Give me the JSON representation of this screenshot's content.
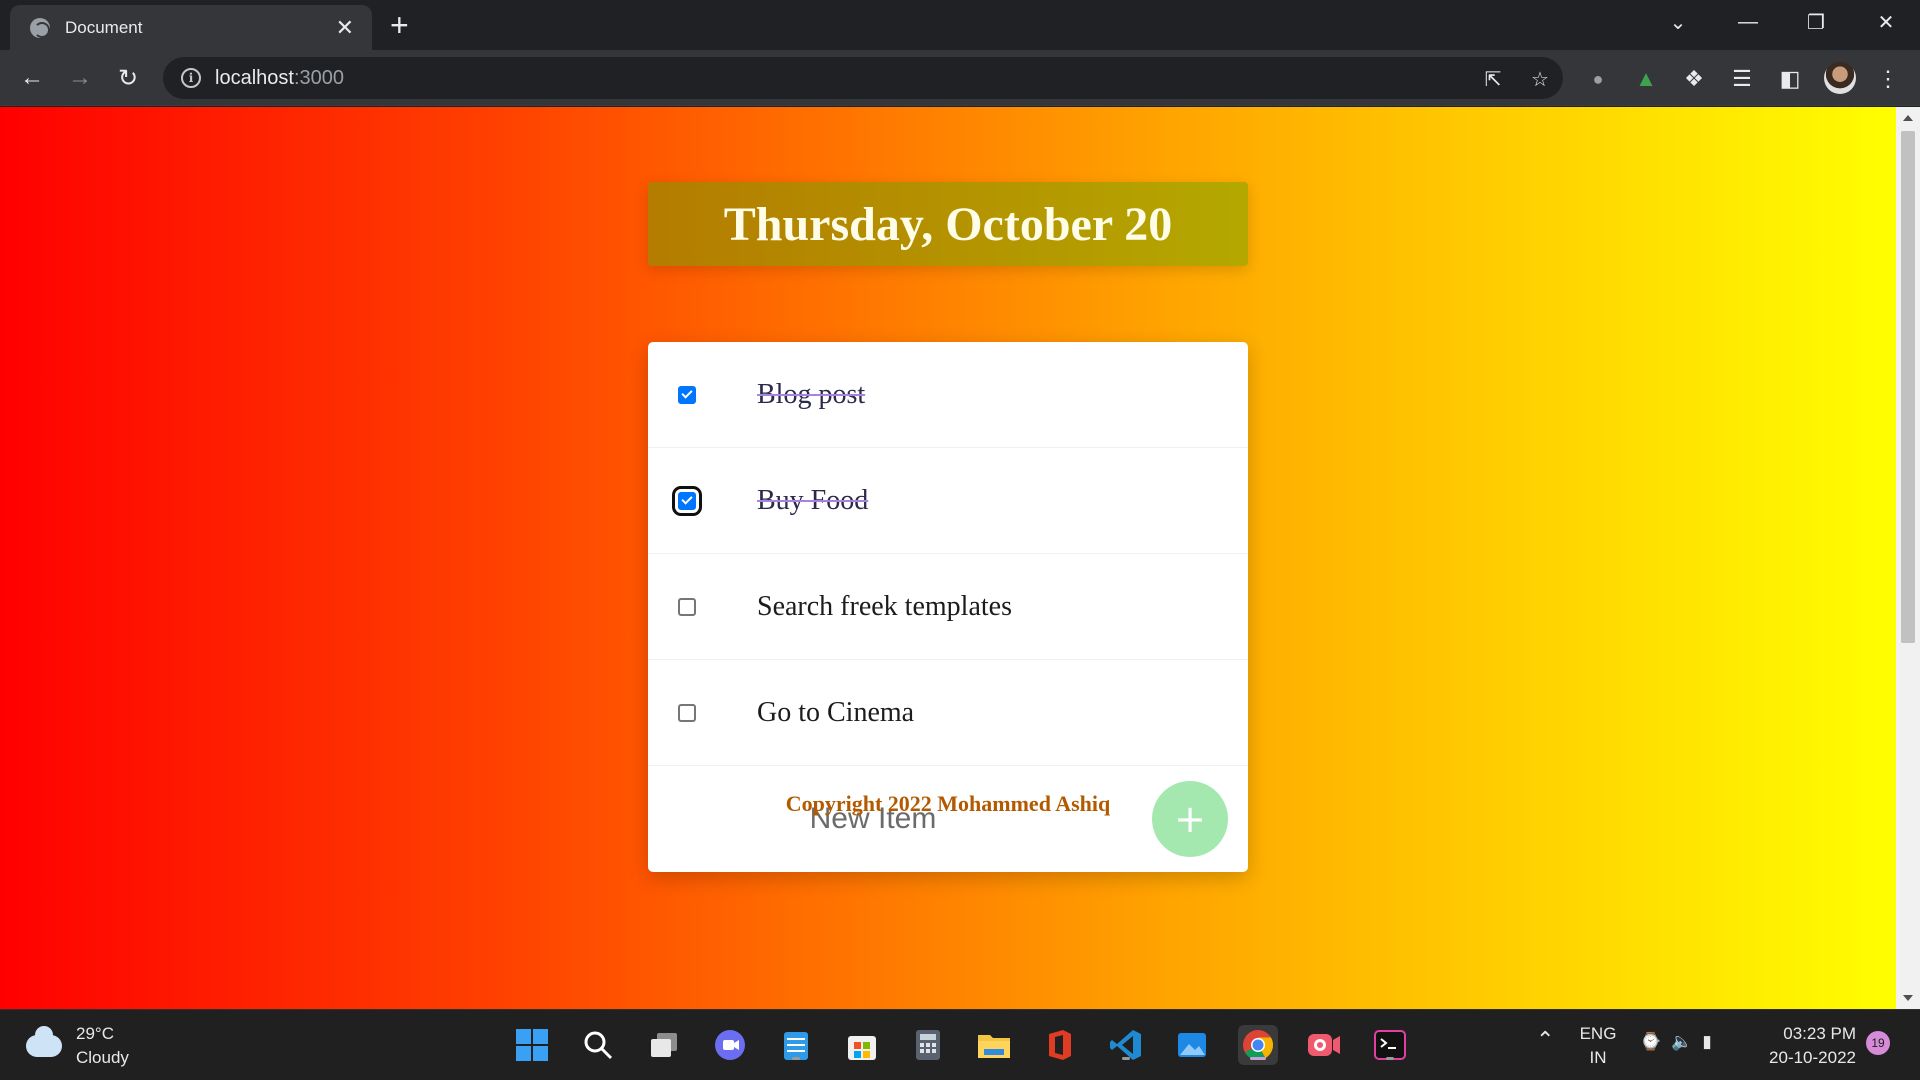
{
  "browser": {
    "tab_title": "Document",
    "tab_close": "✕",
    "new_tab": "+",
    "url_host": "localhost",
    "url_port": ":3000",
    "window_controls": [
      "⌄",
      "—",
      "❐",
      "✕"
    ]
  },
  "page": {
    "heading": "Thursday, October 20",
    "items": [
      {
        "label": "Blog post",
        "checked": true
      },
      {
        "label": "Buy Food",
        "checked": true
      },
      {
        "label": "Search freek templates",
        "checked": false
      },
      {
        "label": "Go to Cinema",
        "checked": false
      }
    ],
    "new_item_placeholder": "New Item",
    "add_button_label": "+",
    "footer": "Copyright 2022 Mohammed Ashiq",
    "colors": {
      "gradient_start": "#ff0000",
      "gradient_end": "#ffff00",
      "heading_bg": "#b48a00",
      "add_button": "#a4e8b0",
      "strike": "#a683e3"
    }
  },
  "taskbar": {
    "weather_temp": "29°C",
    "weather_desc": "Cloudy",
    "lang_top": "ENG",
    "lang_bottom": "IN",
    "time": "03:23 PM",
    "date": "20-10-2022",
    "notification_count": "19",
    "apps": [
      "windows-start",
      "search",
      "task-view",
      "teams-chat",
      "notepad",
      "microsoft-store",
      "calculator",
      "file-explorer",
      "office",
      "vscode",
      "photos",
      "chrome",
      "screen-recorder",
      "terminal"
    ]
  }
}
